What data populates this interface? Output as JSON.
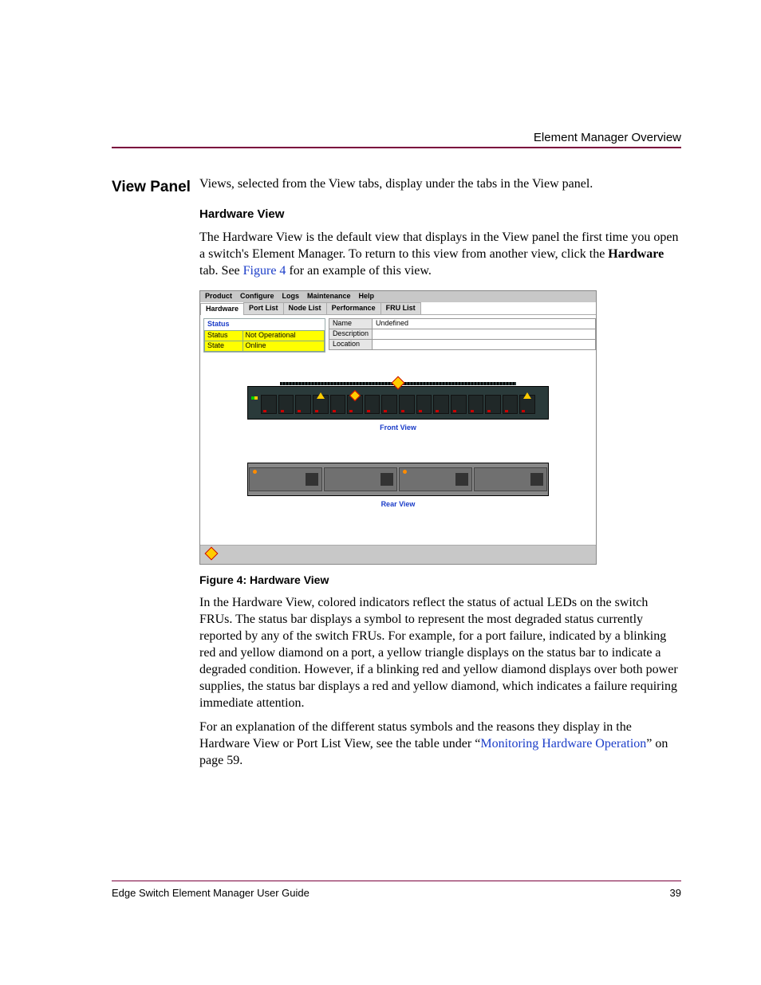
{
  "header": {
    "section": "Element Manager Overview"
  },
  "heading": "View Panel",
  "intro": "Views, selected from the View tabs, display under the tabs in the View panel.",
  "hw_heading": "Hardware View",
  "hw_para": {
    "pre": "The Hardware View is the default view that displays in the View panel the first time you open a switch's Element Manager. To return to this view from another view, click the ",
    "bold": "Hardware",
    "mid": " tab. See ",
    "link": "Figure 4",
    "post": " for an example of this view."
  },
  "app": {
    "menus": [
      "Product",
      "Configure",
      "Logs",
      "Maintenance",
      "Help"
    ],
    "tabs": [
      "Hardware",
      "Port List",
      "Node List",
      "Performance",
      "FRU List"
    ],
    "active_tab_index": 0,
    "status_title": "Status",
    "status_rows": [
      [
        "Status",
        "Not Operational"
      ],
      [
        "State",
        "Online"
      ]
    ],
    "meta_rows": [
      [
        "Name",
        "Undefined"
      ],
      [
        "Description",
        ""
      ],
      [
        "Location",
        ""
      ]
    ],
    "front_label": "Front View",
    "rear_label": "Rear View",
    "front_ports": [
      {
        "warn": null
      },
      {
        "warn": null
      },
      {
        "warn": null
      },
      {
        "warn": "tri"
      },
      {
        "warn": null
      },
      {
        "warn": "dia"
      },
      {
        "warn": null
      },
      {
        "warn": null
      },
      {
        "warn": null
      },
      {
        "warn": null
      },
      {
        "warn": null
      },
      {
        "warn": null
      },
      {
        "warn": null
      },
      {
        "warn": null
      },
      {
        "warn": null
      },
      {
        "warn": "tri"
      }
    ]
  },
  "fig_caption": "Figure 4:  Hardware View",
  "para2": "In the Hardware View, colored indicators reflect the status of actual LEDs on the switch FRUs. The status bar displays a symbol to represent the most degraded status currently reported by any of the switch FRUs. For example, for a port failure, indicated by a blinking red and yellow diamond on a port, a yellow triangle displays on the status bar to indicate a degraded condition. However, if a blinking red and yellow diamond displays over both power supplies, the status bar displays a red and yellow diamond, which indicates a failure requiring immediate attention.",
  "para3": {
    "pre": "For an explanation of the different status symbols and the reasons they display in the Hardware View or Port List View, see the table under “",
    "link": "Monitoring Hardware Operation",
    "post": "” on page 59."
  },
  "footer": {
    "title": "Edge Switch Element Manager User Guide",
    "page": "39"
  }
}
